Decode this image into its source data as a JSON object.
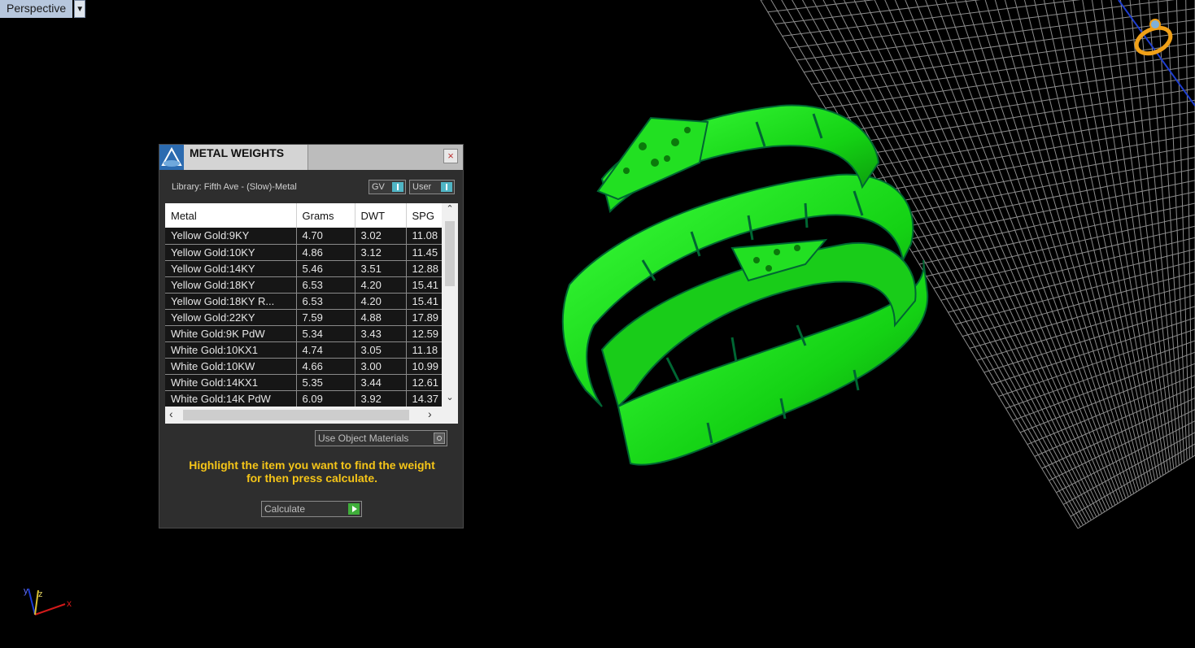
{
  "viewport": {
    "label": "Perspective",
    "dropdown_icon": "triangle-down"
  },
  "panel": {
    "title": "METAL WEIGHTS",
    "close_glyph": "×",
    "library_label": "Library: Fifth Ave - (Slow)-Metal",
    "toggle_gv": "GV",
    "toggle_user": "User",
    "columns": [
      "Metal",
      "Grams",
      "DWT",
      "SPG"
    ],
    "rows": [
      [
        "Yellow Gold:9KY",
        "4.70",
        "3.02",
        "11.08"
      ],
      [
        "Yellow Gold:10KY",
        "4.86",
        "3.12",
        "11.45"
      ],
      [
        "Yellow Gold:14KY",
        "5.46",
        "3.51",
        "12.88"
      ],
      [
        "Yellow Gold:18KY",
        "6.53",
        "4.20",
        "15.41"
      ],
      [
        "Yellow Gold:18KY R...",
        "6.53",
        "4.20",
        "15.41"
      ],
      [
        "Yellow Gold:22KY",
        "7.59",
        "4.88",
        "17.89"
      ],
      [
        "White Gold:9K PdW",
        "5.34",
        "3.43",
        "12.59"
      ],
      [
        "White Gold:10KX1",
        "4.74",
        "3.05",
        "11.18"
      ],
      [
        "White Gold:10KW",
        "4.66",
        "3.00",
        "10.99"
      ],
      [
        "White Gold:14KX1",
        "5.35",
        "3.44",
        "12.61"
      ],
      [
        "White Gold:14K PdW",
        "6.09",
        "3.92",
        "14.37"
      ]
    ],
    "use_object_materials": "Use Object Materials",
    "hint_line1": "Highlight the item you want to find the weight",
    "hint_line2": "for then press calculate.",
    "calculate_label": "Calculate"
  },
  "axes": {
    "x": "x",
    "y": "y",
    "z": "z"
  },
  "colors": {
    "ring": "#1ee61e",
    "hint": "#f5c518",
    "grid": "#9a9a9a",
    "toggle": "#4fb5c5"
  }
}
